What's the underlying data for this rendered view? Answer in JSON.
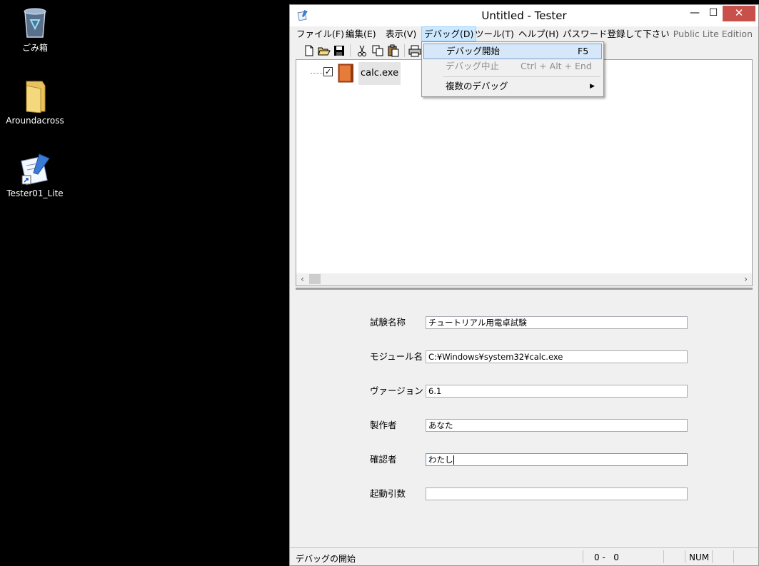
{
  "desktop": {
    "icons": [
      {
        "label": "ごみ箱",
        "icon": "recycle-bin-icon"
      },
      {
        "label": "Aroundacross",
        "icon": "folder-icon"
      },
      {
        "label": "Tester01_Lite",
        "icon": "tester-shortcut-icon"
      }
    ]
  },
  "window": {
    "title": "Untitled - Tester",
    "controls": {
      "minimize": "—",
      "maximize": "☐",
      "close": "✕"
    }
  },
  "menubar": {
    "items": [
      {
        "label": "ファイル(F)"
      },
      {
        "label": "編集(E)"
      },
      {
        "label": "表示(V)"
      },
      {
        "label": "デバッグ(D)"
      },
      {
        "label": "ツール(T)"
      },
      {
        "label": "ヘルプ(H)"
      },
      {
        "label": "パスワード登録して下さい"
      }
    ],
    "edition": "Public Lite Edition"
  },
  "toolbar": {
    "icons": [
      "new-file-icon",
      "open-folder-icon",
      "save-icon",
      "cut-icon",
      "copy-icon",
      "paste-icon",
      "print-icon"
    ]
  },
  "tree": {
    "node_label": "calc.exe",
    "checked": true
  },
  "form": {
    "fields": [
      {
        "label": "試験名称",
        "value": "チュートリアル用電卓試験"
      },
      {
        "label": "モジュール名",
        "value": "C:¥Windows¥system32¥calc.exe"
      },
      {
        "label": "ヴァージョン",
        "value": "6.1"
      },
      {
        "label": "製作者",
        "value": "あなた"
      },
      {
        "label": "確認者",
        "value": "わたし"
      },
      {
        "label": "起動引数",
        "value": ""
      }
    ]
  },
  "statusbar": {
    "text": "デバッグの開始",
    "position": "0 -   0",
    "num": "NUM"
  },
  "debug_menu": {
    "items": [
      {
        "label": "デバッグ開始",
        "shortcut": "F5"
      },
      {
        "label": "デバッグ中止",
        "shortcut": "Ctrl + Alt + End"
      },
      {
        "label": "複数のデバッグ",
        "shortcut": ""
      }
    ]
  }
}
